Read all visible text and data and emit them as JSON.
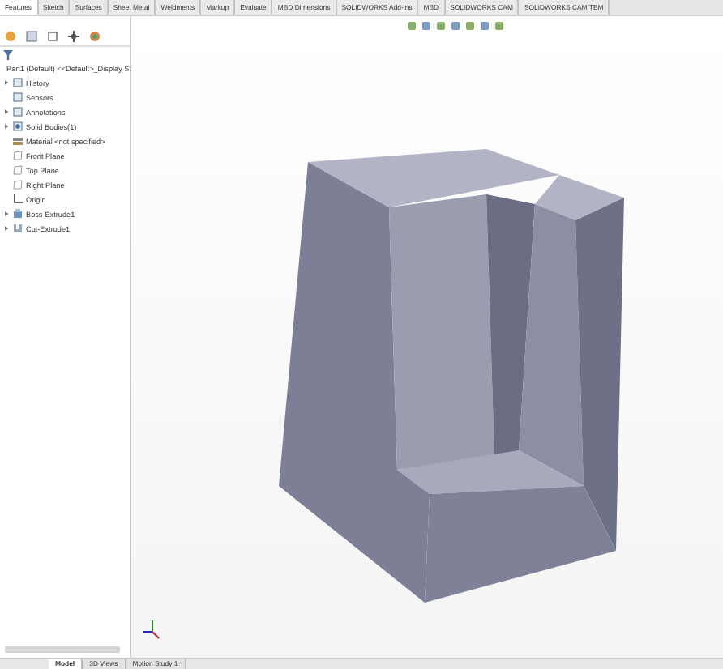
{
  "ribbon_tabs": [
    {
      "label": "Features",
      "selected": true
    },
    {
      "label": "Sketch",
      "selected": false
    },
    {
      "label": "Surfaces",
      "selected": false
    },
    {
      "label": "Sheet Metal",
      "selected": false
    },
    {
      "label": "Weldments",
      "selected": false
    },
    {
      "label": "Markup",
      "selected": false
    },
    {
      "label": "Evaluate",
      "selected": false
    },
    {
      "label": "MBD Dimensions",
      "selected": false
    },
    {
      "label": "SOLIDWORKS Add-ins",
      "selected": false
    },
    {
      "label": "MBD",
      "selected": false
    },
    {
      "label": "SOLIDWORKS CAM",
      "selected": false
    },
    {
      "label": "SOLIDWORKS CAM TBM",
      "selected": false
    }
  ],
  "feature_tree": {
    "root": "Part1 (Default) <<Default>_Display St",
    "items": [
      {
        "label": "History",
        "kind": "folder",
        "expandable": true
      },
      {
        "label": "Sensors",
        "kind": "folder",
        "expandable": false
      },
      {
        "label": "Annotations",
        "kind": "folder",
        "expandable": true
      },
      {
        "label": "Solid Bodies(1)",
        "kind": "bodies",
        "expandable": true
      },
      {
        "label": "Material <not specified>",
        "kind": "material",
        "expandable": false
      },
      {
        "label": "Front Plane",
        "kind": "plane",
        "expandable": false
      },
      {
        "label": "Top Plane",
        "kind": "plane",
        "expandable": false
      },
      {
        "label": "Right Plane",
        "kind": "plane",
        "expandable": false
      },
      {
        "label": "Origin",
        "kind": "origin",
        "expandable": false
      },
      {
        "label": "Boss-Extrude1",
        "kind": "extrude",
        "expandable": true
      },
      {
        "label": "Cut-Extrude1",
        "kind": "cut",
        "expandable": true
      }
    ]
  },
  "bottom_tabs": [
    {
      "label": "Model",
      "selected": true
    },
    {
      "label": "3D Views",
      "selected": false
    },
    {
      "label": "Motion Study 1",
      "selected": false
    }
  ]
}
